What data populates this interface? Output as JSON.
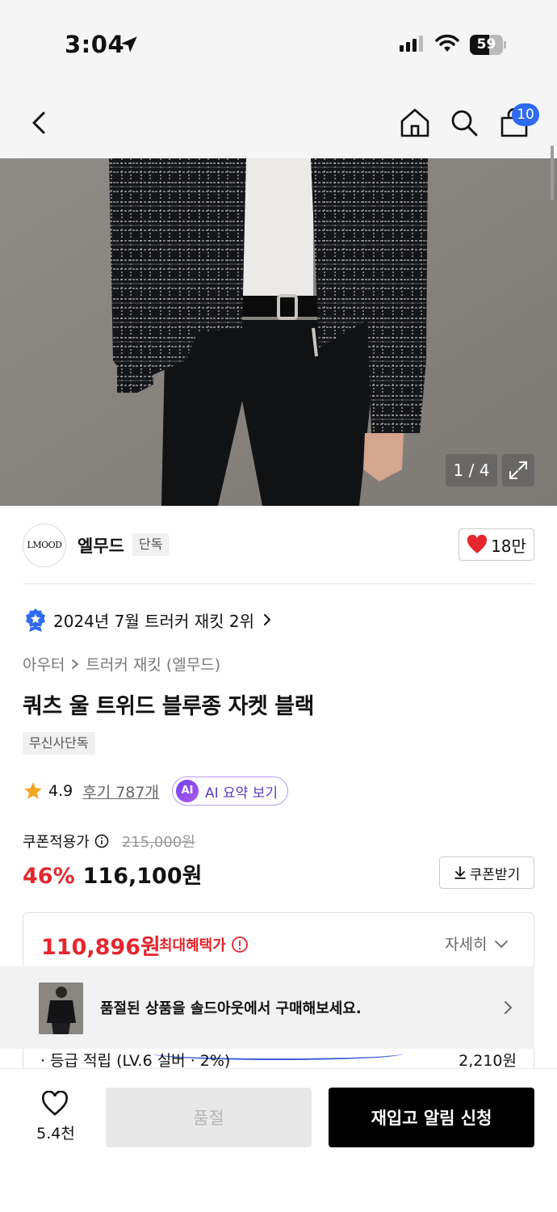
{
  "status": {
    "time": "3:04",
    "battery": "59",
    "battery_level": 0.59
  },
  "nav": {
    "cart_count": "10"
  },
  "gallery": {
    "counter": "1 / 4"
  },
  "brand": {
    "logo_text": "LMOOD",
    "name": "엘무드",
    "tag": "단독",
    "likes": "18만"
  },
  "product": {
    "rank": "2024년 7월 트러커 재킷 2위",
    "breadcrumb": [
      "아우터",
      "트러커 재킷 (엘무드)"
    ],
    "title": "쿼츠 울 트위드 블루종 자켓 블랙",
    "exclusive_tag": "무신사단독",
    "rating": "4.9",
    "reviews": "후기 787개",
    "ai_label": "AI 요약 보기",
    "ai_badge": "AI"
  },
  "pricing": {
    "coupon_label": "쿠폰적용가",
    "original_price": "215,000원",
    "discount": "46%",
    "price": "116,100원",
    "coupon_button": "쿠폰받기"
  },
  "benefit": {
    "max_price": "110,896원",
    "max_label": "최대혜택가",
    "detail": "자세히",
    "soldout_message": "품절된 상품을 솔드아웃에서 구매해보세요.",
    "points_label": "· 등급 적립 (LV.6 실버 · 2%)",
    "points_value": "2,210원"
  },
  "footer": {
    "wish_count": "5.4천",
    "soldout_label": "품절",
    "restock_label": "재입고 알림 신청"
  },
  "colors": {
    "accent_red": "#e5262d",
    "badge_blue": "#2f6bf2",
    "ai_purple": "#6f3ff5"
  }
}
